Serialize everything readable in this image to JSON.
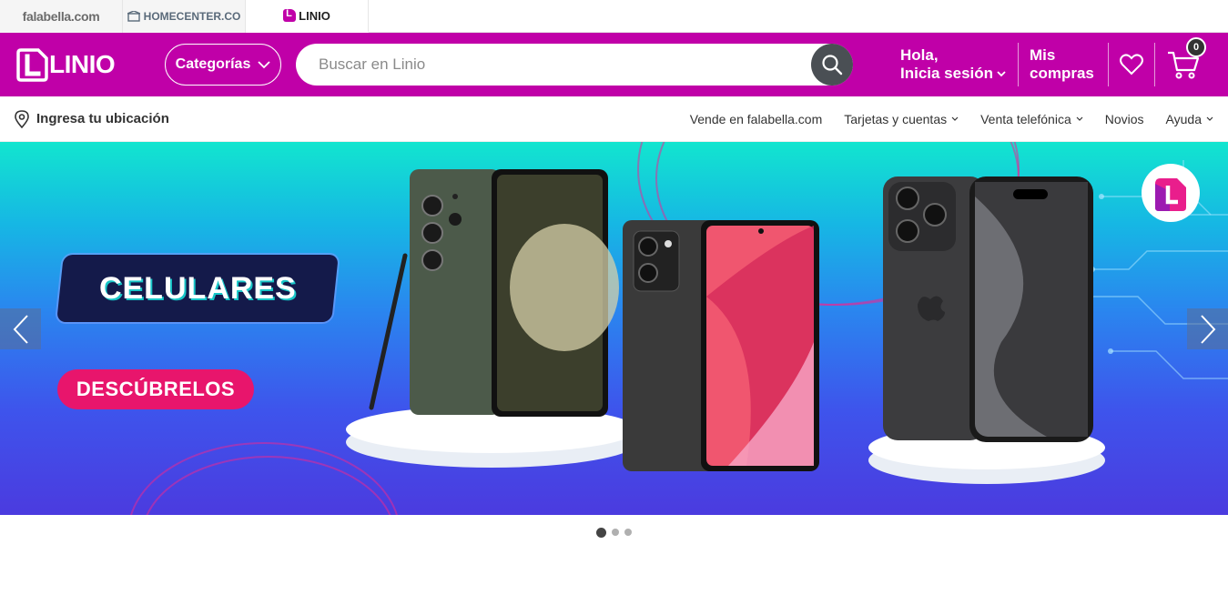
{
  "brand_strip": {
    "tabs": [
      {
        "label": "falabella.com"
      },
      {
        "label": "HOMECENTER.CO"
      },
      {
        "label": "LINIO"
      }
    ]
  },
  "header": {
    "logo_text": "LINIO",
    "categories_label": "Categorías",
    "search_placeholder": "Buscar en Linio",
    "account_line1": "Hola,",
    "account_line2": "Inicia sesión",
    "orders_line1": "Mis",
    "orders_line2": "compras",
    "cart_count": "0",
    "colors": {
      "brand": "#c000a8",
      "search_button": "#4a4f54"
    }
  },
  "subnav": {
    "location_label": "Ingresa tu ubicación",
    "links": [
      {
        "label": "Vende en falabella.com"
      },
      {
        "label": "Tarjetas y cuentas"
      },
      {
        "label": "Venta telefónica"
      },
      {
        "label": "Novios"
      },
      {
        "label": "Ayuda"
      }
    ]
  },
  "banner": {
    "title": "CELULARES",
    "cta": "DESCÚBRELOS",
    "slides_total": 3,
    "active_slide": 1,
    "cta_color": "#e8156c"
  }
}
